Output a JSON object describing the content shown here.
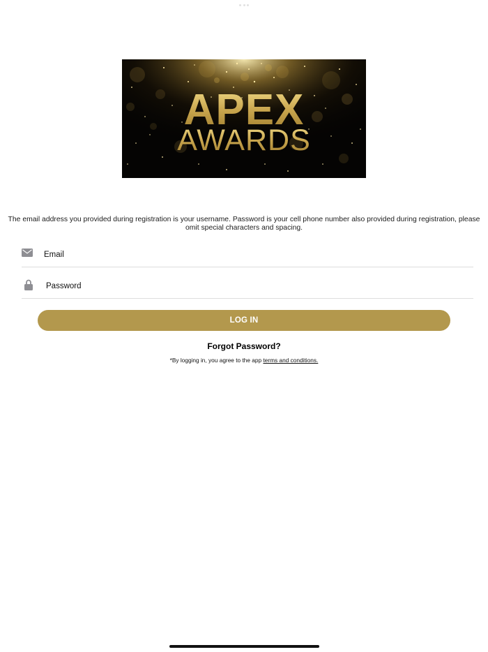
{
  "banner": {
    "line1": "APEX",
    "line2": "AWARDS",
    "gold": "#c9a64e",
    "background": "#050403"
  },
  "instructions": "The email address you provided during registration is your username. Password is your cell phone number also provided during registration, please omit special characters and spacing.",
  "form": {
    "email_placeholder": "Email",
    "password_placeholder": "Password",
    "email_icon": "envelope-icon",
    "password_icon": "lock-icon"
  },
  "login_label": "LOG IN",
  "forgot_label": "Forgot Password?",
  "terms": {
    "prefix": "*By logging in, you agree to the app ",
    "link": "terms and conditions."
  },
  "colors": {
    "accent": "#b3984d",
    "divider": "#dddddd",
    "icon": "#8e8e93"
  }
}
